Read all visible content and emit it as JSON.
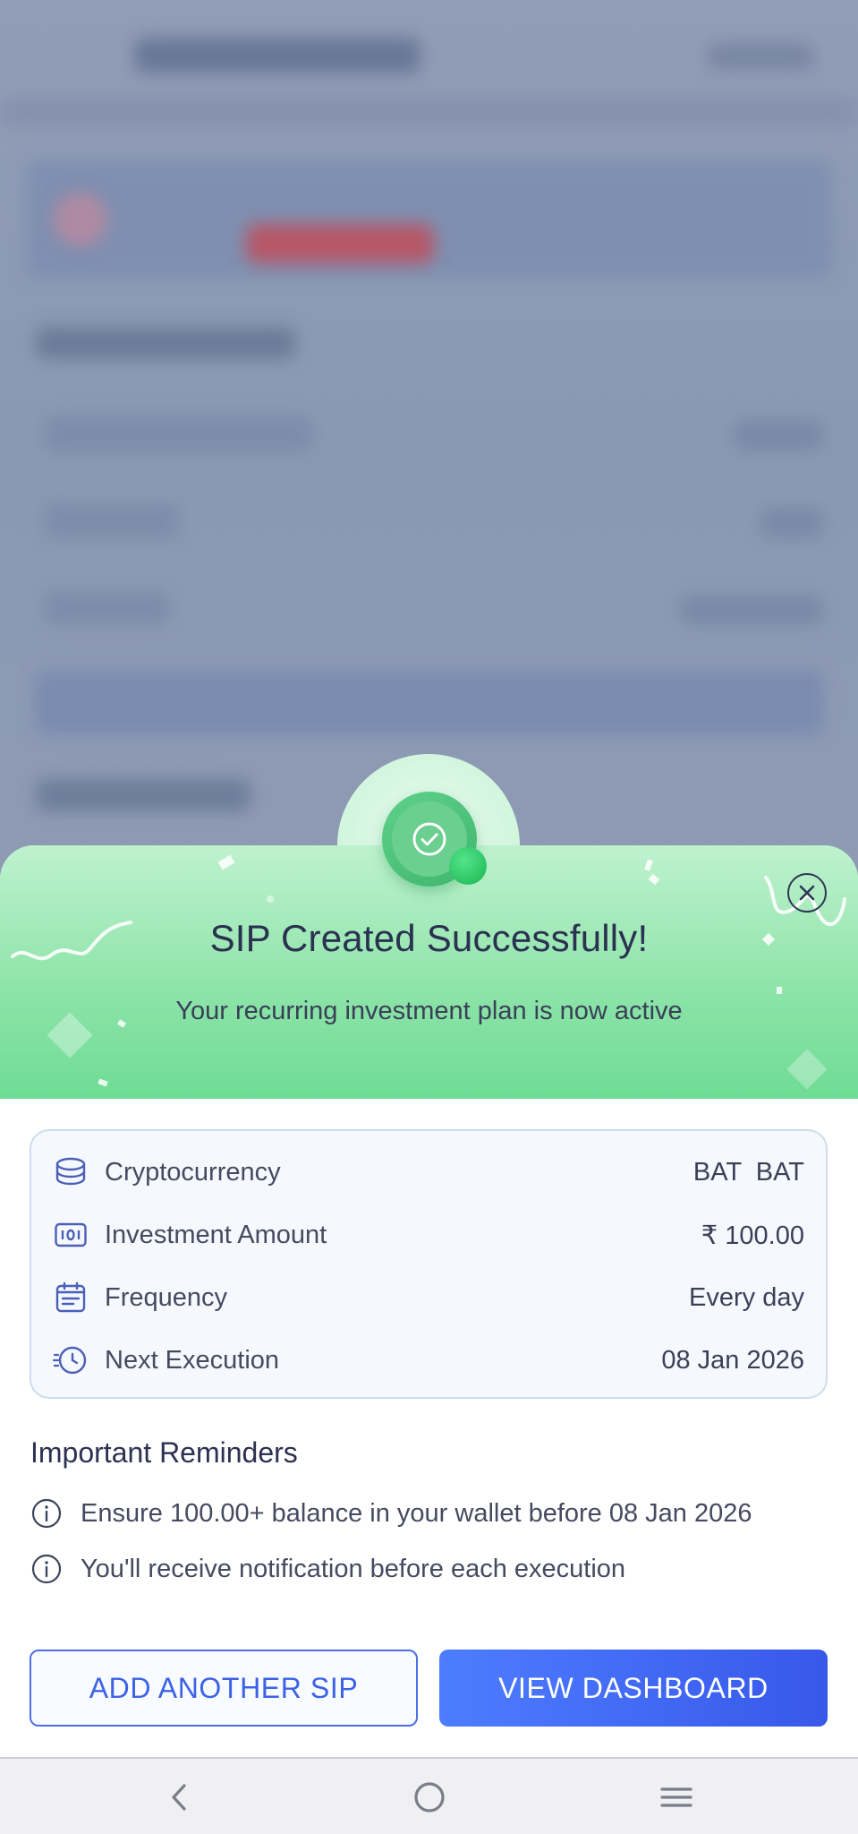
{
  "dialog": {
    "title": "SIP Created Successfully!",
    "subtitle": "Your recurring investment plan is now active",
    "close_icon": "close-icon",
    "success_icon": "check-circle-icon"
  },
  "details": {
    "rows": [
      {
        "icon": "coins-stack-icon",
        "label": "Cryptocurrency",
        "value": "BAT  BAT"
      },
      {
        "icon": "money-note-icon",
        "label": "Investment Amount",
        "value": "₹ 100.00"
      },
      {
        "icon": "calendar-icon",
        "label": "Frequency",
        "value": "Every day"
      },
      {
        "icon": "clock-icon",
        "label": "Next Execution",
        "value": "08 Jan 2026"
      }
    ]
  },
  "reminders": {
    "title": "Important Reminders",
    "items": [
      {
        "icon": "info-icon",
        "text": "Ensure 100.00+ balance in your wallet before 08 Jan 2026"
      },
      {
        "icon": "info-icon",
        "text": "You'll receive notification before each execution"
      }
    ]
  },
  "actions": {
    "secondary_label": "ADD ANOTHER SIP",
    "primary_label": "VIEW DASHBOARD"
  },
  "navbar": {
    "back_icon": "back-chevron-icon",
    "home_icon": "home-circle-icon",
    "menu_icon": "recents-menu-icon"
  },
  "colors": {
    "accent": "#3d62e6",
    "success_green": "#6edc94",
    "text_dark": "#2b3150"
  }
}
